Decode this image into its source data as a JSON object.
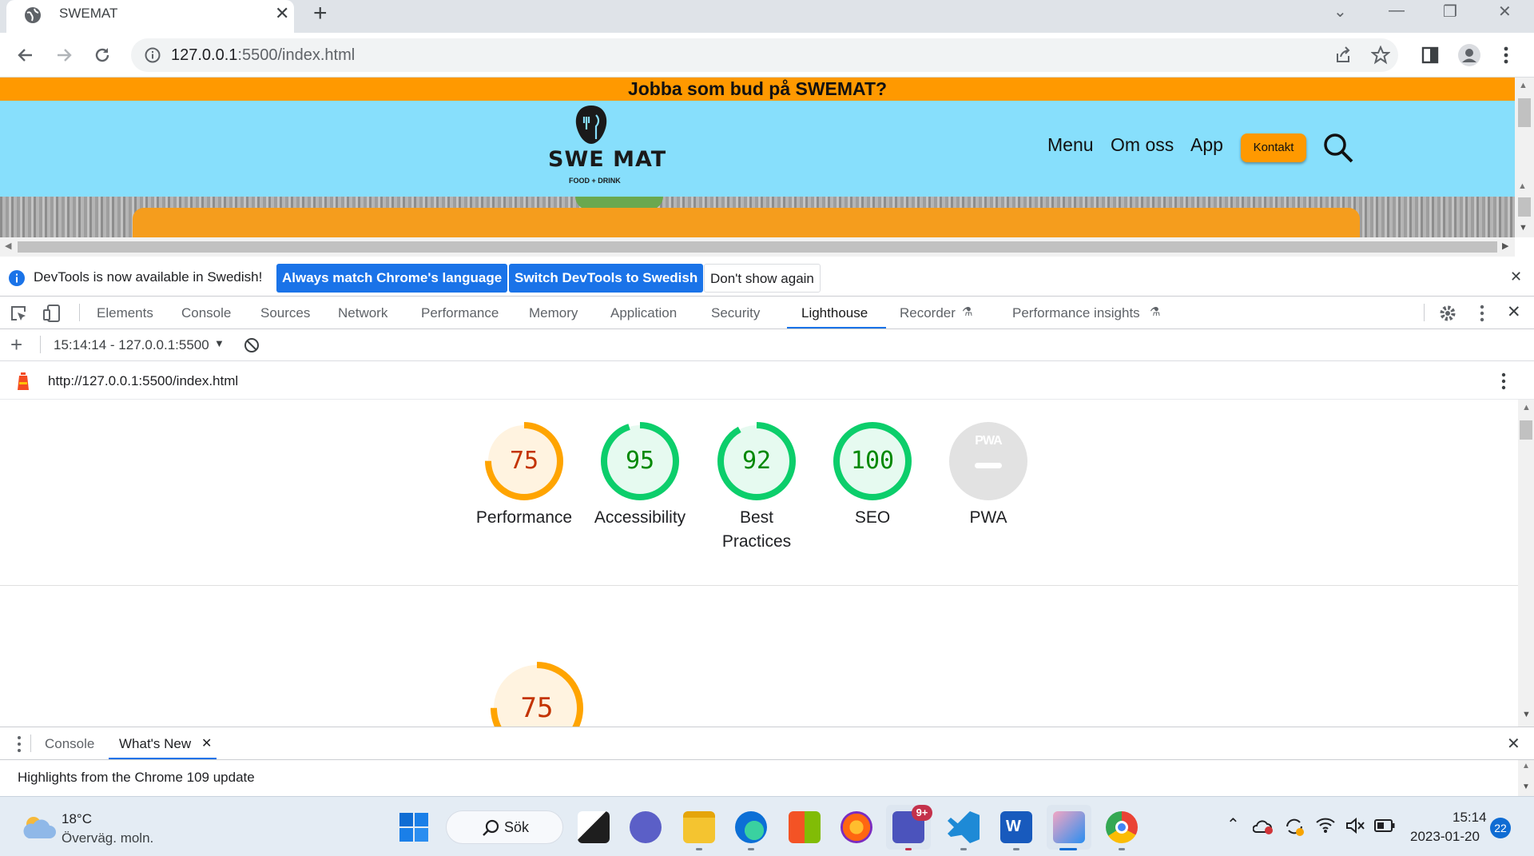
{
  "browser": {
    "tab_title": "SWEMAT",
    "url_host": "127.0.0.1",
    "url_rest": ":5500/index.html"
  },
  "site": {
    "banner": "Jobba som bud på SWEMAT?",
    "logo_text": "SWE MAT",
    "logo_sub": "FOOD + DRINK",
    "nav": [
      "Menu",
      "Om oss",
      "App"
    ],
    "contact_button": "Kontakt"
  },
  "infobar": {
    "message": "DevTools is now available in Swedish!",
    "btn_match": "Always match Chrome's language",
    "btn_switch": "Switch DevTools to Swedish",
    "btn_dismiss": "Don't show again"
  },
  "devtools": {
    "tabs": [
      "Elements",
      "Console",
      "Sources",
      "Network",
      "Performance",
      "Memory",
      "Application",
      "Security",
      "Lighthouse",
      "Recorder",
      "Performance insights"
    ],
    "active_tab": "Lighthouse",
    "report_selector": "15:14:14 - 127.0.0.1:5500",
    "report_url": "http://127.0.0.1:5500/index.html"
  },
  "lighthouse": {
    "scores": [
      {
        "label": "Performance",
        "value": "75",
        "fraction": 0.75,
        "color": "#ffa400",
        "text_color": "#c33300",
        "bg": "#fff3e0"
      },
      {
        "label": "Accessibility",
        "value": "95",
        "fraction": 0.95,
        "color": "#0cce6b",
        "text_color": "#008800",
        "bg": "#e6faf0"
      },
      {
        "label": "Best Practices",
        "value": "92",
        "fraction": 0.92,
        "color": "#0cce6b",
        "text_color": "#008800",
        "bg": "#e6faf0"
      },
      {
        "label": "SEO",
        "value": "100",
        "fraction": 1.0,
        "color": "#0cce6b",
        "text_color": "#008800",
        "bg": "#e6faf0"
      }
    ],
    "pwa_label": "PWA",
    "pwa_badge": "PWA",
    "detail_score": "75"
  },
  "drawer": {
    "tabs": [
      "Console",
      "What's New"
    ],
    "active_tab": "What's New",
    "content": "Highlights from the Chrome 109 update"
  },
  "taskbar": {
    "weather_temp": "18°C",
    "weather_desc": "Överväg. moln.",
    "search_label": "Sök",
    "time": "15:14",
    "date": "2023-01-20",
    "notification_count": "22",
    "teams_badge": "9+"
  }
}
